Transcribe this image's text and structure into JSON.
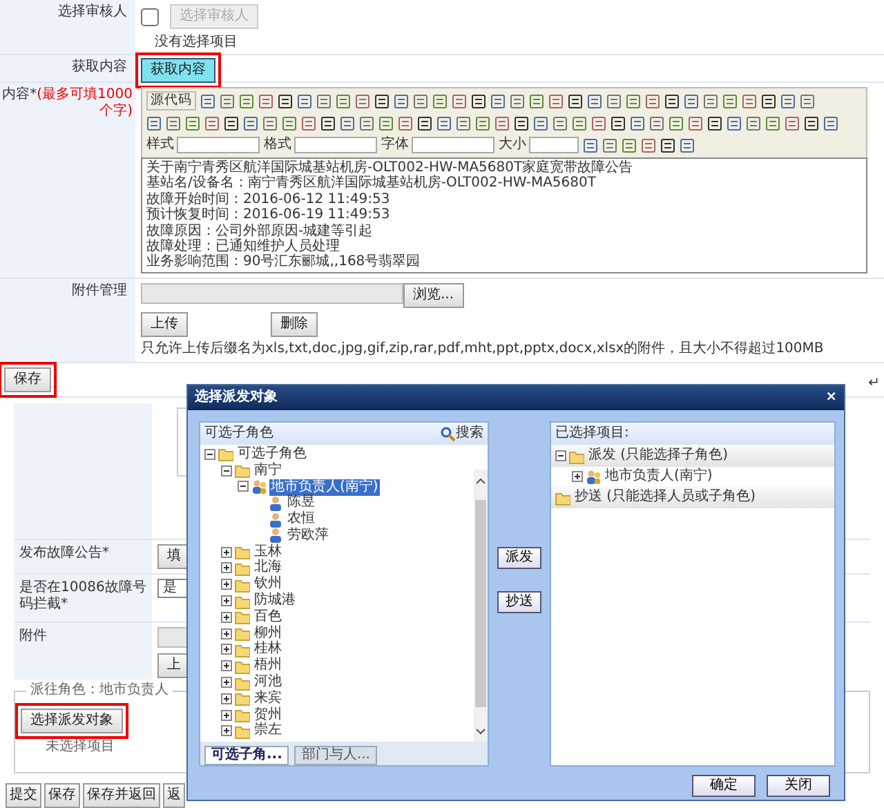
{
  "reviewer": {
    "label": "选择审核人",
    "checked": false,
    "button": "选择审核人",
    "button_disabled": true,
    "status": "没有选择项目"
  },
  "fetch": {
    "label": "获取内容",
    "button": "获取内容"
  },
  "content": {
    "label": "内容*",
    "hint": "(最多可填1000个字)",
    "source_button": "源代码",
    "dropdowns": [
      "样式",
      "格式",
      "字体",
      "大小"
    ],
    "lines": [
      "关于南宁青秀区航洋国际城基站机房-OLT002-HW-MA5680T家庭宽带故障公告",
      "基站名/设备名：南宁青秀区航洋国际城基站机房-OLT002-HW-MA5680T",
      "故障开始时间：2016-06-12 11:49:53",
      "预计恢复时间：2016-06-19 11:49:53",
      "故障原因：公司外部原因-城建等引起",
      "故障处理：已通知维护人员处理",
      "业务影响范围：90号汇东郦城,,168号翡翠园"
    ]
  },
  "attachment": {
    "label": "附件管理",
    "browse": "浏览...",
    "upload": "上传",
    "delete": "删除",
    "note": "只允许上传后缀名为xls,txt,doc,jpg,gif,zip,rar,pdf,mht,ppt,pptx,docx,xlsx的附件，且大小不得超过100MB"
  },
  "save": "保存",
  "return_mark": "↵",
  "form2": {
    "rows": [
      {
        "label": "发布故障公告*",
        "kind": "button",
        "value": "填"
      },
      {
        "label": "是否在10086故障号码拦截*",
        "kind": "select",
        "value": "是"
      },
      {
        "label": "附件",
        "kind": "upload",
        "value": "上"
      }
    ],
    "dispatch_legend": "派往角色：地市负责人",
    "dispatch_button": "选择派发对象",
    "dispatch_status": "未选择项目",
    "buttons": [
      "提交",
      "保存",
      "保存并返回",
      "返"
    ]
  },
  "dialog": {
    "title": "选择派发对象",
    "close": "×",
    "left": {
      "header": "可选子角色",
      "search": "搜索",
      "tree": [
        {
          "label": "可选子角色",
          "kind": "folder",
          "expanded": true,
          "selected": false,
          "children": [
            {
              "label": "南宁",
              "kind": "folder",
              "expanded": true,
              "selected": false,
              "children": [
                {
                  "label": "地市负责人(南宁)",
                  "kind": "role",
                  "expanded": true,
                  "selected": true,
                  "children": [
                    {
                      "label": "陈昱",
                      "kind": "user",
                      "selected": false
                    },
                    {
                      "label": "农恒",
                      "kind": "user",
                      "selected": false
                    },
                    {
                      "label": "劳欧萍",
                      "kind": "user",
                      "selected": false
                    }
                  ]
                }
              ]
            },
            {
              "label": "玉林",
              "kind": "folder",
              "expanded": false,
              "selected": false
            },
            {
              "label": "北海",
              "kind": "folder",
              "expanded": false,
              "selected": false
            },
            {
              "label": "钦州",
              "kind": "folder",
              "expanded": false,
              "selected": false
            },
            {
              "label": "防城港",
              "kind": "folder",
              "expanded": false,
              "selected": false
            },
            {
              "label": "百色",
              "kind": "folder",
              "expanded": false,
              "selected": false
            },
            {
              "label": "柳州",
              "kind": "folder",
              "expanded": false,
              "selected": false
            },
            {
              "label": "桂林",
              "kind": "folder",
              "expanded": false,
              "selected": false
            },
            {
              "label": "梧州",
              "kind": "folder",
              "expanded": false,
              "selected": false
            },
            {
              "label": "河池",
              "kind": "folder",
              "expanded": false,
              "selected": false
            },
            {
              "label": "来宾",
              "kind": "folder",
              "expanded": false,
              "selected": false
            },
            {
              "label": "贺州",
              "kind": "folder",
              "expanded": false,
              "selected": false
            },
            {
              "label": "崇左",
              "kind": "folder",
              "expanded": false,
              "selected": false
            }
          ]
        }
      ],
      "tabs": [
        {
          "label": "可选子角...",
          "selected": true
        },
        {
          "label": "部门与人...",
          "selected": false
        }
      ]
    },
    "middle_buttons": [
      "派发",
      "抄送"
    ],
    "right": {
      "header": "已选择项目:",
      "tree": [
        {
          "label": "派发 (只能选择子角色)",
          "kind": "folder",
          "expanded": true,
          "children": [
            {
              "label": "地市负责人(南宁)",
              "kind": "role",
              "expanded": false
            }
          ]
        },
        {
          "label": "抄送 (只能选择人员或子角色)",
          "kind": "folder"
        }
      ]
    },
    "buttons": [
      "确定",
      "关闭"
    ]
  }
}
